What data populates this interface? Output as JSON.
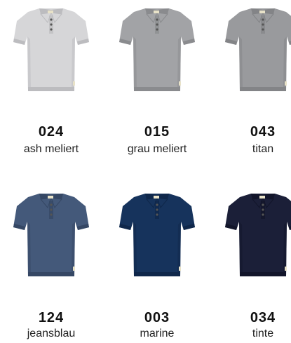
{
  "swatches": [
    {
      "code": "024",
      "name": "ash meliert",
      "color": "#d6d6d8",
      "shade": "#bcbcbf"
    },
    {
      "code": "015",
      "name": "grau meliert",
      "color": "#a2a3a6",
      "shade": "#8a8b8e"
    },
    {
      "code": "043",
      "name": "titan",
      "color": "#999a9d",
      "shade": "#838487"
    },
    {
      "code": "124",
      "name": "jeansblau",
      "color": "#44597a",
      "shade": "#354764"
    },
    {
      "code": "003",
      "name": "marine",
      "color": "#16335c",
      "shade": "#0f274a"
    },
    {
      "code": "034",
      "name": "tinte",
      "color": "#1b1f38",
      "shade": "#12152a"
    }
  ],
  "icon": "polo-shirt-icon"
}
